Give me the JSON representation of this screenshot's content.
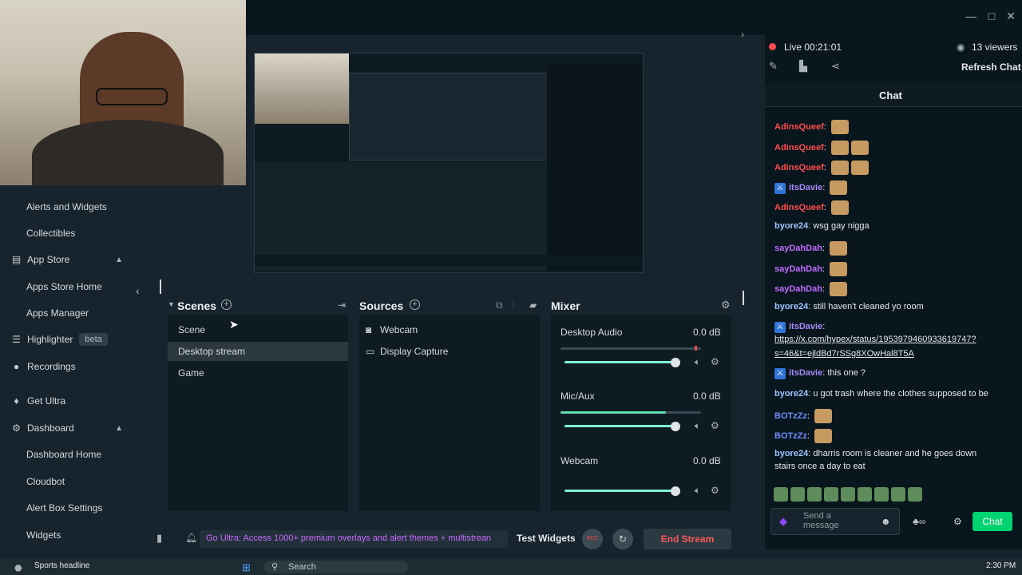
{
  "sidebar": {
    "items": [
      {
        "label": "Alerts and Widgets",
        "type": "sub"
      },
      {
        "label": "Collectibles",
        "type": "sub"
      },
      {
        "label": "App Store",
        "type": "main",
        "icon": "store-icon",
        "expanded": true
      },
      {
        "label": "Apps Store Home",
        "type": "sub"
      },
      {
        "label": "Apps Manager",
        "type": "sub"
      },
      {
        "label": "Highlighter",
        "type": "main",
        "icon": "highlighter-icon",
        "badge": "beta"
      },
      {
        "label": "Recordings",
        "type": "main",
        "icon": "recordings-icon"
      },
      {
        "label": "Get Ultra",
        "type": "main",
        "icon": "ultra-icon"
      },
      {
        "label": "Dashboard",
        "type": "main",
        "icon": "dashboard-icon",
        "expanded": true
      },
      {
        "label": "Dashboard Home",
        "type": "sub"
      },
      {
        "label": "Cloudbot",
        "type": "sub"
      },
      {
        "label": "Alert Box Settings",
        "type": "sub"
      },
      {
        "label": "Widgets",
        "type": "sub"
      }
    ]
  },
  "scenes": {
    "title": "Scenes",
    "items": [
      "Scene",
      "Desktop stream",
      "Game"
    ],
    "selected": 1
  },
  "sources": {
    "title": "Sources",
    "items": [
      {
        "label": "Webcam",
        "icon": "camera-icon"
      },
      {
        "label": "Display Capture",
        "icon": "monitor-icon"
      }
    ]
  },
  "mixer": {
    "title": "Mixer",
    "channels": [
      {
        "name": "Desktop Audio",
        "db": "0.0 dB",
        "level": 0.0,
        "volume": 0.9
      },
      {
        "name": "Mic/Aux",
        "db": "0.0 dB",
        "level": 0.75,
        "volume": 0.9
      },
      {
        "name": "Webcam",
        "db": "0.0 dB",
        "level": 0.0,
        "volume": 0.9
      }
    ]
  },
  "bottom": {
    "promo": "Go Ultra: Access 1000+ premium overlays and alert themes + multistrean",
    "test_widgets": "Test Widgets",
    "rec": "REC",
    "end_stream": "End Stream"
  },
  "chat": {
    "live_label": "Live 00:21:01",
    "viewers": "13 viewers",
    "refresh": "Refresh Chat",
    "title": "Chat",
    "messages": [
      {
        "user": "AdinsQueef",
        "color": "#ff4d4d",
        "text": "",
        "emotes": 1
      },
      {
        "user": "AdinsQueef",
        "color": "#ff4d4d",
        "text": "",
        "emotes": 2
      },
      {
        "user": "AdinsQueef",
        "color": "#ff4d4d",
        "text": "",
        "emotes": 2
      },
      {
        "user": "itsDavie",
        "color": "#a78bfa",
        "text": "",
        "emotes": 1,
        "badge": true
      },
      {
        "user": "AdinsQueef",
        "color": "#ff4d4d",
        "text": "",
        "emotes": 1
      },
      {
        "user": "byore24",
        "color": "#9ec5ff",
        "text": "wsg gay nigga",
        "emotes": 0
      },
      {
        "user": "sayDahDah",
        "color": "#c06cff",
        "text": "",
        "emotes": 1
      },
      {
        "user": "sayDahDah",
        "color": "#c06cff",
        "text": "",
        "emotes": 1
      },
      {
        "user": "sayDahDah",
        "color": "#c06cff",
        "text": "",
        "emotes": 1
      },
      {
        "user": "byore24",
        "color": "#9ec5ff",
        "text": "still haven't cleaned yo room",
        "emotes": 0
      },
      {
        "user": "itsDavie",
        "color": "#a78bfa",
        "text": "",
        "emotes": 0,
        "badge": true
      },
      {
        "user": "",
        "color": "#ffffff",
        "text": "https://x.com/hypex/status/1953979460933619747?",
        "emotes": 0,
        "link": true
      },
      {
        "user": "",
        "color": "#ffffff",
        "text": "s=46&t=ejldBd7rSSg8XOwHal8T5A",
        "emotes": 0,
        "link": true
      },
      {
        "user": "itsDavie",
        "color": "#a78bfa",
        "text": "this one ?",
        "emotes": 0,
        "badge": true
      },
      {
        "user": "byore24",
        "color": "#9ec5ff",
        "text": "u got trash where the clothes supposed to be",
        "emotes": 0
      },
      {
        "user": "BOTzZz",
        "color": "#6f8cff",
        "text": "",
        "emotes": 1
      },
      {
        "user": "BOTzZz",
        "color": "#6f8cff",
        "text": "",
        "emotes": 1
      },
      {
        "user": "byore24",
        "color": "#9ec5ff",
        "text": "dharris room is cleaner and he goes down",
        "emotes": 0
      },
      {
        "user": "",
        "color": "#ffffff",
        "text": "stairs once a day to eat",
        "emotes": 0
      }
    ],
    "input_placeholder": "Send a message",
    "send_label": "Chat"
  },
  "taskbar": {
    "news": "Sports headline",
    "search": "Search",
    "time": "2:30 PM"
  }
}
